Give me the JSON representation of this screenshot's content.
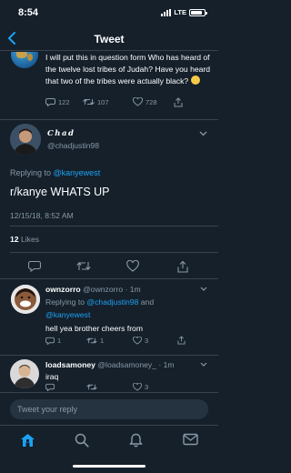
{
  "status_bar": {
    "time": "8:54",
    "network": "LTE",
    "battery_level": 0.85
  },
  "header": {
    "title": "Tweet"
  },
  "parent_tweet": {
    "text": "I will put this in question form    Who has heard of the twelve lost tribes of Judah?  Have you heard that two of the tribes were actually black?",
    "replies": "122",
    "retweets": "107",
    "likes": "728"
  },
  "focus_tweet": {
    "display_name": "Chad",
    "handle": "@chadjustin98",
    "replying_prefix": "Replying to ",
    "replying_to": "@kanyewest",
    "text": "r/kanye WHATS UP",
    "timestamp": "12/15/18, 8:52 AM",
    "like_count": "12",
    "likes_label": "Likes"
  },
  "replies": [
    {
      "display_name": "ownzorro",
      "meta": "@ownzorro · 1m",
      "replying_prefix": "Replying to ",
      "mention_1": "@chadjustin98",
      "joiner": " and",
      "mention_2": "@kanyewest",
      "text": "hell yea brother cheers from",
      "reply_count": "1",
      "retweet_count": "1",
      "like_count": "3"
    },
    {
      "display_name": "loadsamoney",
      "meta": "@loadsamoney_ · 1m",
      "text": "iraq",
      "reply_count": "",
      "retweet_count": "",
      "like_count": "3"
    }
  ],
  "compose": {
    "placeholder": "Tweet your reply"
  },
  "colors": {
    "background": "#15202b",
    "accent": "#1da1f2",
    "secondary_text": "#8899a6",
    "divider": "#38444d"
  },
  "icons": {
    "tabs": [
      "home-icon",
      "search-icon",
      "notifications-icon",
      "messages-icon"
    ],
    "actions": [
      "reply-icon",
      "retweet-icon",
      "like-icon",
      "share-icon"
    ]
  }
}
